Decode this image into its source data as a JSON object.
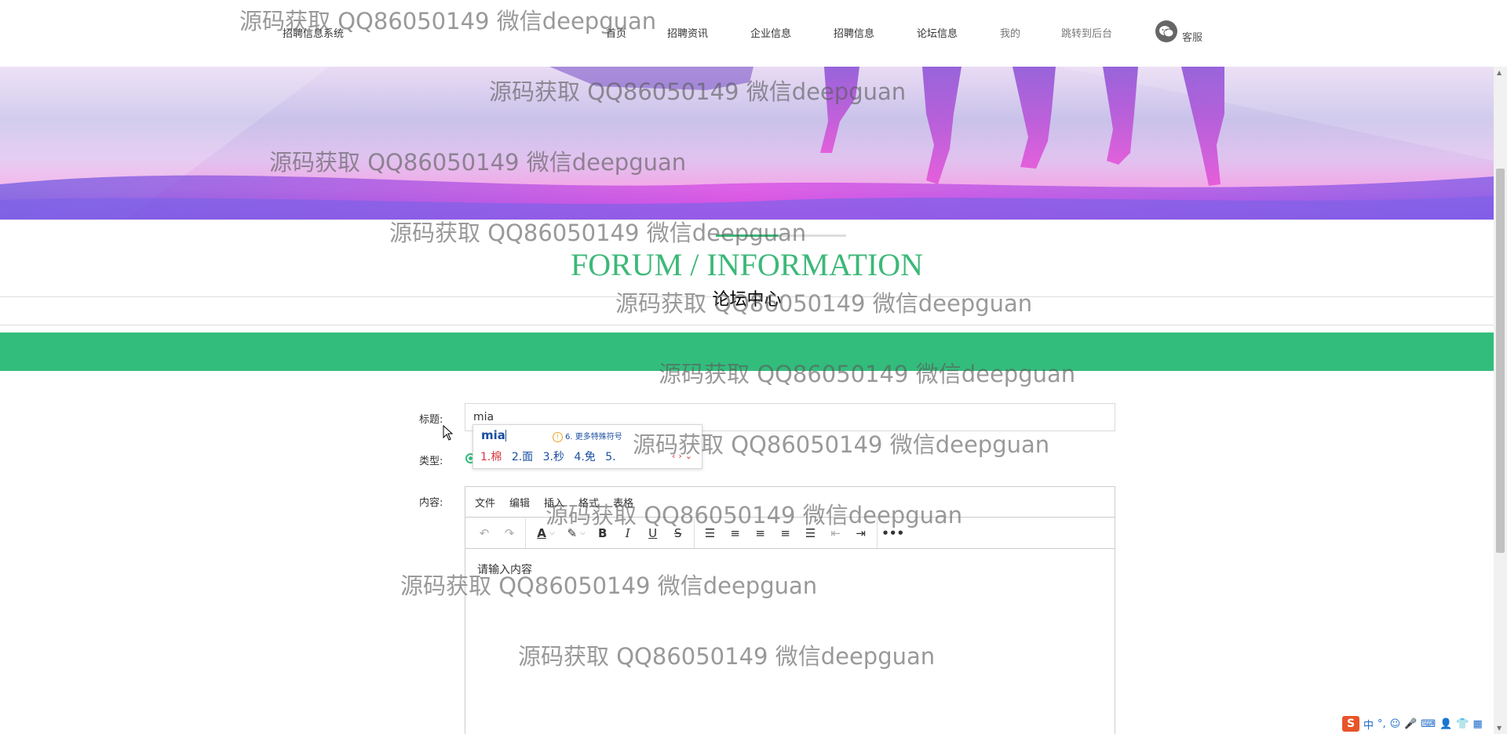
{
  "header": {
    "site_title": "招聘信息系统",
    "nav": [
      "首页",
      "招聘资讯",
      "企业信息",
      "招聘信息",
      "论坛信息",
      "我的",
      "跳转到后台"
    ],
    "service_label": "客服"
  },
  "section": {
    "title_en": "FORUM / INFORMATION",
    "title_cn": "论坛中心"
  },
  "form": {
    "title_label": "标题:",
    "title_value": "mia",
    "type_label": "类型:",
    "content_label": "内容:"
  },
  "editor": {
    "menu": [
      "文件",
      "编辑",
      "插入",
      "格式",
      "表格"
    ],
    "placeholder": "请输入内容"
  },
  "ime": {
    "composition": "mia",
    "hint": "6. 更多特殊符号",
    "candidates": [
      "1.棉",
      "2.面",
      "3.秒",
      "4.免",
      "5."
    ]
  },
  "watermark": "源码获取 QQ86050149 微信deepguan",
  "tray": [
    "中",
    "°,"
  ],
  "colors": {
    "accent_green": "#33bd7c",
    "heading_green": "#3cb878"
  }
}
